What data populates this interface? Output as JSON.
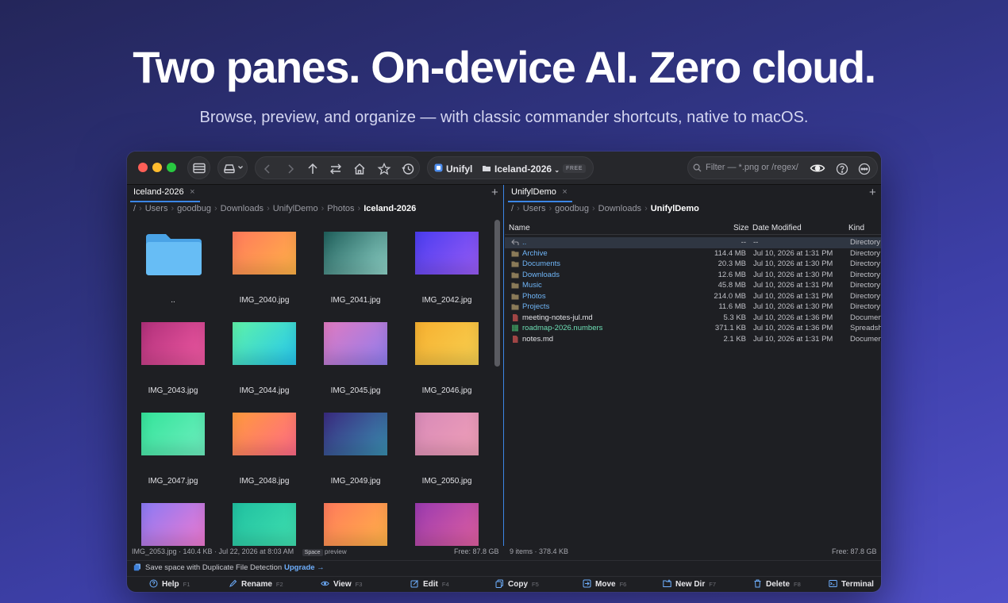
{
  "hero": {
    "headline": "Two panes. On-device AI. Zero cloud.",
    "subhead": "Browse, preview, and organize — with classic commander shortcuts, native to macOS."
  },
  "toolbar": {
    "app_name": "Unifyl",
    "location": "Iceland-2026",
    "badge": "FREE",
    "filter_placeholder": "Filter — *.png or /regex/"
  },
  "left_pane": {
    "tab": "Iceland-2026",
    "breadcrumb": [
      "/",
      "Users",
      "goodbug",
      "Downloads",
      "UnifylDemo",
      "Photos",
      "Iceland-2026"
    ],
    "items": [
      {
        "label": "..",
        "type": "folder"
      },
      {
        "label": "IMG_2040.jpg",
        "gradient": "#ff7a5c,#ffb347"
      },
      {
        "label": "IMG_2041.jpg",
        "gradient": "#1f5f5b,#8fd3c8"
      },
      {
        "label": "IMG_2042.jpg",
        "gradient": "#4a3df0,#9a5cf5"
      },
      {
        "label": "IMG_2043.jpg",
        "gradient": "#b0307a,#f05aa3"
      },
      {
        "label": "IMG_2044.jpg",
        "gradient": "#5ef2a8,#26c6f0"
      },
      {
        "label": "IMG_2045.jpg",
        "gradient": "#e07ac0,#8f7ef0"
      },
      {
        "label": "IMG_2046.jpg",
        "gradient": "#f7b030,#f7d050"
      },
      {
        "label": "IMG_2047.jpg",
        "gradient": "#34e39a,#6fefc0"
      },
      {
        "label": "IMG_2048.jpg",
        "gradient": "#ff9a3c,#ff6a88"
      },
      {
        "label": "IMG_2049.jpg",
        "gradient": "#3a2a80,#3a8fb0"
      },
      {
        "label": "IMG_2050.jpg",
        "gradient": "#d88ab8,#f0a0b8"
      },
      {
        "label": "",
        "gradient": "#8a7af5,#f07ad0"
      },
      {
        "label": "",
        "gradient": "#20c0a0,#40e0b0"
      },
      {
        "label": "",
        "gradient": "#ff7a5c,#ffb347"
      },
      {
        "label": "",
        "gradient": "#9a3ab0,#e060a0"
      }
    ],
    "status": "IMG_2053.jpg · 140.4 KB · Jul 22, 2026 at 8:03 AM",
    "hint_key": "Space",
    "hint_text": "preview",
    "free": "Free: 87.8 GB"
  },
  "right_pane": {
    "tab": "UnifylDemo",
    "breadcrumb": [
      "/",
      "Users",
      "goodbug",
      "Downloads",
      "UnifylDemo"
    ],
    "columns": {
      "name": "Name",
      "size": "Size",
      "date": "Date Modified",
      "kind": "Kind"
    },
    "rows": [
      {
        "name": "..",
        "size": "--",
        "date": "--",
        "kind": "Directory",
        "type": "up"
      },
      {
        "name": "Archive",
        "size": "114.4 MB",
        "date": "Jul 10, 2026 at 1:31 PM",
        "kind": "Directory",
        "type": "dir"
      },
      {
        "name": "Documents",
        "size": "20.3 MB",
        "date": "Jul 10, 2026 at 1:30 PM",
        "kind": "Directory",
        "type": "dir"
      },
      {
        "name": "Downloads",
        "size": "12.6 MB",
        "date": "Jul 10, 2026 at 1:30 PM",
        "kind": "Directory",
        "type": "dir"
      },
      {
        "name": "Music",
        "size": "45.8 MB",
        "date": "Jul 10, 2026 at 1:31 PM",
        "kind": "Directory",
        "type": "dir"
      },
      {
        "name": "Photos",
        "size": "214.0 MB",
        "date": "Jul 10, 2026 at 1:31 PM",
        "kind": "Directory",
        "type": "dir"
      },
      {
        "name": "Projects",
        "size": "11.6 MB",
        "date": "Jul 10, 2026 at 1:30 PM",
        "kind": "Directory",
        "type": "dir"
      },
      {
        "name": "meeting-notes-jul.md",
        "size": "5.3 KB",
        "date": "Jul 10, 2026 at 1:36 PM",
        "kind": "Documen",
        "type": "file"
      },
      {
        "name": "roadmap-2026.numbers",
        "size": "371.1 KB",
        "date": "Jul 10, 2026 at 1:36 PM",
        "kind": "Spreadsh",
        "type": "numbers"
      },
      {
        "name": "notes.md",
        "size": "2.1 KB",
        "date": "Jul 10, 2026 at 1:31 PM",
        "kind": "Documen",
        "type": "file"
      }
    ],
    "status": "9 items · 378.4 KB",
    "free": "Free: 87.8 GB"
  },
  "promo": {
    "text": "Save space with Duplicate File Detection",
    "link": "Upgrade →"
  },
  "fkeys": [
    {
      "label": "Help",
      "key": "F1",
      "icon": "help-icon"
    },
    {
      "label": "Rename",
      "key": "F2",
      "icon": "pencil-icon"
    },
    {
      "label": "View",
      "key": "F3",
      "icon": "eye-icon"
    },
    {
      "label": "Edit",
      "key": "F4",
      "icon": "edit-icon"
    },
    {
      "label": "Copy",
      "key": "F5",
      "icon": "copy-icon"
    },
    {
      "label": "Move",
      "key": "F6",
      "icon": "move-icon"
    },
    {
      "label": "New Dir",
      "key": "F7",
      "icon": "new-folder-icon"
    },
    {
      "label": "Delete",
      "key": "F8",
      "icon": "trash-icon"
    },
    {
      "label": "Terminal",
      "key": "",
      "icon": "terminal-icon"
    }
  ]
}
